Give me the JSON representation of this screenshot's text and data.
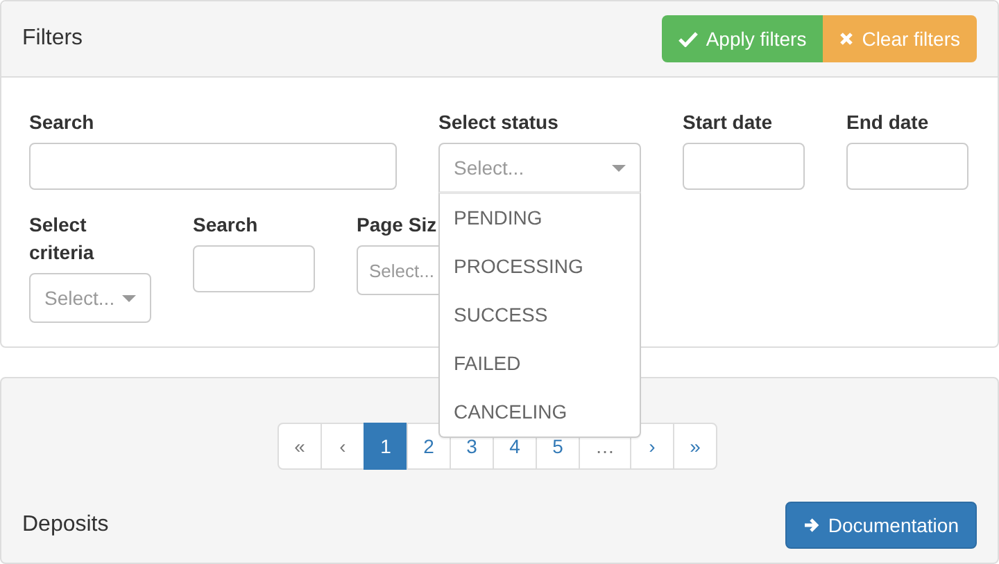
{
  "filters": {
    "title": "Filters",
    "buttons": [
      {
        "label": "Apply filters",
        "kind": "apply"
      },
      {
        "label": "Clear filters",
        "kind": "clear"
      }
    ],
    "rows": [
      [
        {
          "label": "Search",
          "kind": "text"
        },
        {
          "label": "Select status",
          "kind": "select",
          "placeholder": "Select...",
          "expanded": true,
          "options": [
            "PENDING",
            "PROCESSING",
            "SUCCESS",
            "FAILED",
            "CANCELING"
          ]
        },
        {
          "label": "Start date",
          "kind": "text"
        },
        {
          "label": "End date",
          "kind": "text"
        }
      ],
      [
        {
          "label": "Select criteria",
          "kind": "select",
          "placeholder": "Select..."
        },
        {
          "label": "Search",
          "kind": "text"
        },
        {
          "label": "Page Siz",
          "kind": "select",
          "placeholder": "Select..."
        }
      ]
    ]
  },
  "results": {
    "pagination": [
      {
        "label": "«",
        "selected": false,
        "disabled": true
      },
      {
        "label": "‹",
        "selected": false,
        "disabled": true
      },
      {
        "label": "1",
        "selected": true,
        "disabled": false
      },
      {
        "label": "2",
        "selected": false,
        "disabled": false
      },
      {
        "label": "3",
        "selected": false,
        "disabled": false
      },
      {
        "label": "4",
        "selected": false,
        "disabled": false
      },
      {
        "label": "5",
        "selected": false,
        "disabled": false
      },
      {
        "label": "…",
        "selected": false,
        "disabled": true
      },
      {
        "label": "›",
        "selected": false,
        "disabled": false
      },
      {
        "label": "»",
        "selected": false,
        "disabled": false
      }
    ],
    "title": "Deposits",
    "button": "Documentation"
  }
}
